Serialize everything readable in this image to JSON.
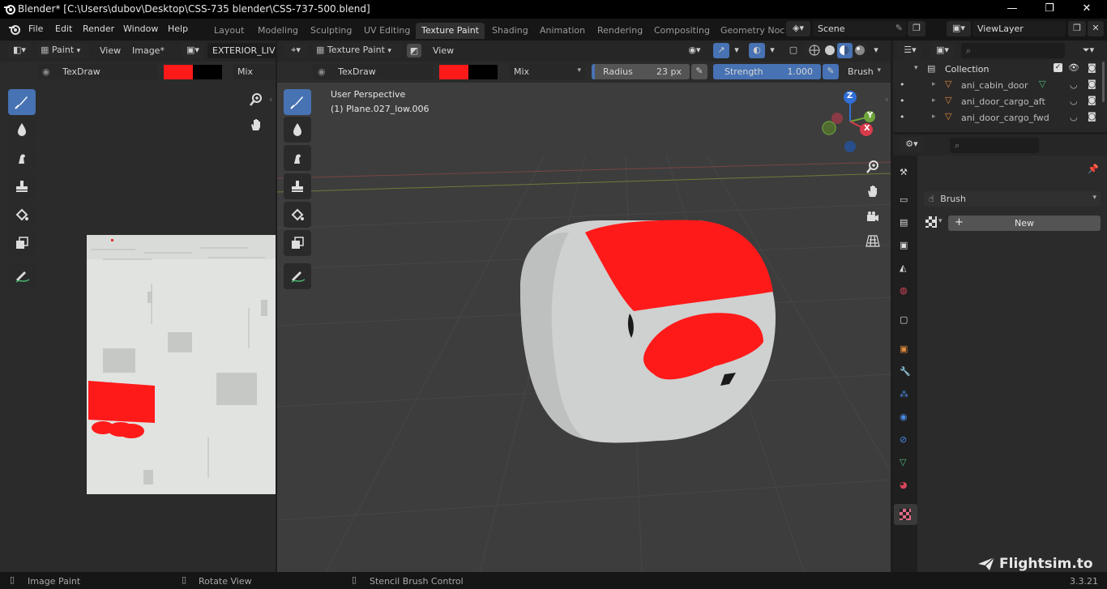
{
  "window": {
    "title": "Blender* [C:\\Users\\dubov\\Desktop\\CSS-735 blender\\CSS-737-500.blend]",
    "minimize": "—",
    "maximize": "❐",
    "close": "✕"
  },
  "menu": [
    "File",
    "Edit",
    "Render",
    "Window",
    "Help"
  ],
  "workspaces": [
    "Layout",
    "Modeling",
    "Sculpting",
    "UV Editing",
    "Texture Paint",
    "Shading",
    "Animation",
    "Rendering",
    "Compositing",
    "Geometry Noc"
  ],
  "active_workspace": "Texture Paint",
  "scene": {
    "name": "Scene"
  },
  "view_layer": {
    "name": "ViewLayer"
  },
  "image_editor": {
    "mode": "Paint",
    "view": "View",
    "image_menu": "Image*",
    "image_name": "EXTERIOR_LIVE",
    "brush": "TexDraw",
    "blend": "Mix"
  },
  "viewport": {
    "mode": "Texture Paint",
    "view": "View",
    "brush": "TexDraw",
    "blend": "Mix",
    "radius_label": "Radius",
    "radius_value": "23 px",
    "strength_label": "Strength",
    "strength_value": "1.000",
    "strength_fill": 1.0,
    "brush_menu": "Brush",
    "perspective": "User Perspective",
    "object": "(1) Plane.027_low.006",
    "gizmo": {
      "z": "Z",
      "y": "Y",
      "x": "X"
    }
  },
  "outliner": {
    "collection": "Collection",
    "items": [
      "ani_cabin_door",
      "ani_door_cargo_aft",
      "ani_door_cargo_fwd"
    ]
  },
  "properties": {
    "brush_label": "Brush",
    "new_button": "New"
  },
  "colors": {
    "paint_red": "#ff1a1a",
    "accent_blue": "#4772b3",
    "strength_blue": "#4772b3"
  },
  "status": {
    "left": "Image Paint",
    "middle": "Rotate View",
    "right": "Stencil Brush Control",
    "watermark": "Flightsim.to",
    "version": "3.3.21"
  }
}
